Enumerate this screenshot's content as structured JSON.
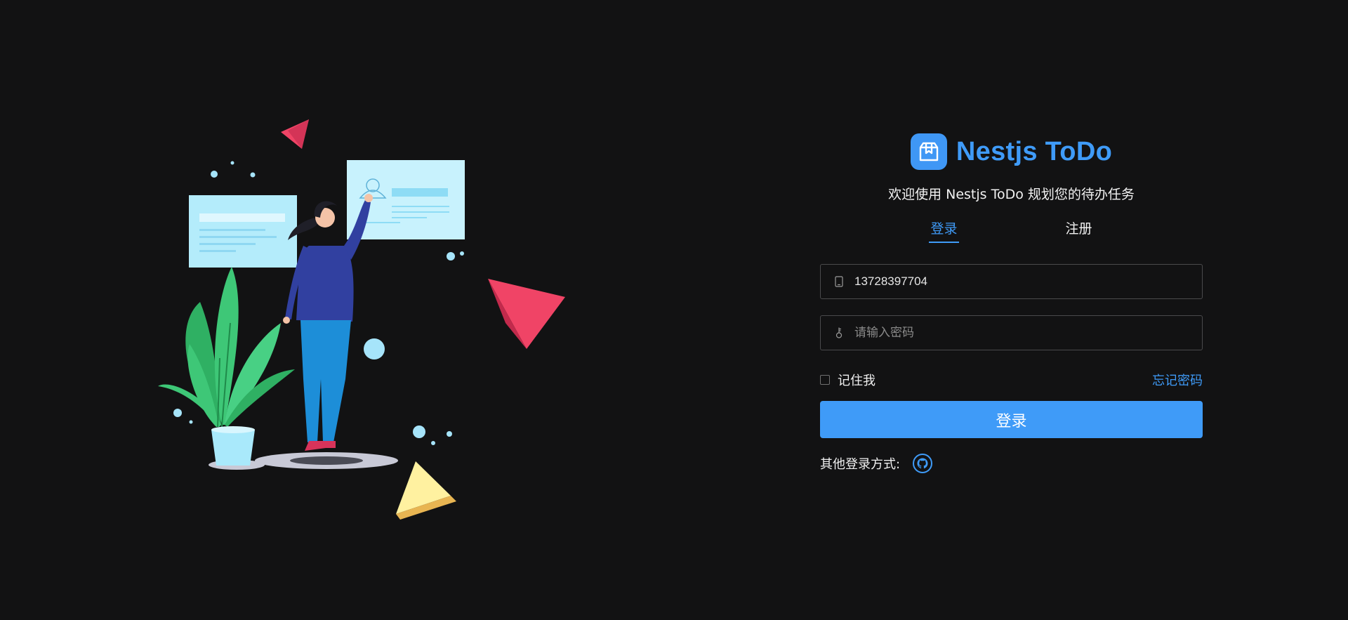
{
  "brand": {
    "name": "Nestjs ToDo",
    "subtitle": "欢迎使用 Nestjs ToDo 规划您的待办任务"
  },
  "tabs": [
    {
      "label": "登录",
      "active": true
    },
    {
      "label": "注册",
      "active": false
    }
  ],
  "form": {
    "phone_value": "13728397704",
    "password_placeholder": "请输入密码",
    "remember_label": "记住我",
    "remember_checked": false,
    "forgot_label": "忘记密码",
    "submit_label": "登录"
  },
  "other_login": {
    "label": "其他登录方式:",
    "providers": [
      "github-icon"
    ]
  },
  "colors": {
    "background": "#121213",
    "accent": "#3f9bf8",
    "input_border": "#4a4a4c"
  }
}
